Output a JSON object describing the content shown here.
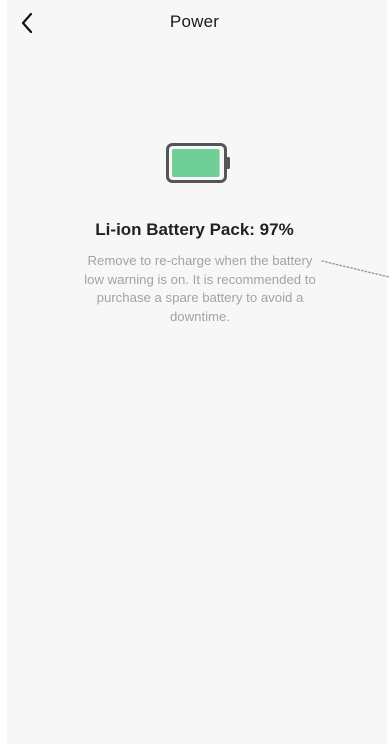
{
  "header": {
    "title": "Power"
  },
  "battery": {
    "name": "Li-ion Battery Pack: 97%",
    "level_percent": 97,
    "color": "#6fcf97",
    "description": "Remove to re-charge when the battery low warning is on. It is recommended to purchase a spare battery to avoid a downtime."
  },
  "icons": {
    "back": "chevron-left-icon",
    "battery": "battery-icon"
  }
}
